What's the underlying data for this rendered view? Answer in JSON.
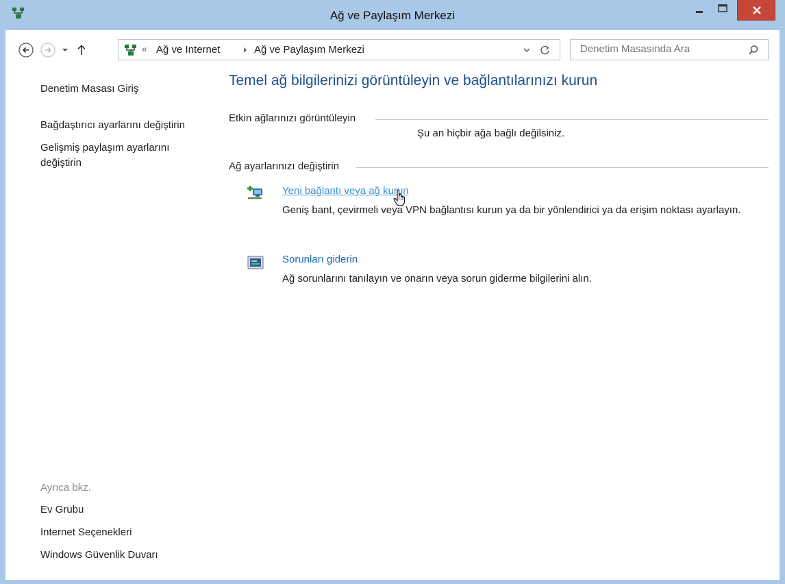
{
  "window": {
    "title": "Ağ ve Paylaşım Merkezi",
    "controls": {
      "minimize": "minimize",
      "maximize": "maximize",
      "close": "close"
    }
  },
  "address_bar": {
    "overflow": "«",
    "breadcrumbs": [
      "Ağ ve Internet",
      "Ağ ve Paylaşım Merkezi"
    ],
    "search_placeholder": "Denetim Masasında Ara"
  },
  "sidebar": {
    "links": [
      {
        "label": "Denetim Masası Giriş"
      },
      {
        "label": "Bağdaştırıcı ayarlarını değiştirin"
      },
      {
        "label": "Gelişmiş paylaşım ayarlarını\ndeğiştirin"
      }
    ],
    "see_also_label": "Ayrıca bkz.",
    "see_also": [
      {
        "label": "Ev Grubu"
      },
      {
        "label": "Internet Seçenekleri"
      },
      {
        "label": "Windows Güvenlik Duvarı"
      }
    ]
  },
  "main": {
    "title": "Temel ağ bilgilerinizi görüntüleyin ve bağlantılarınızı kurun",
    "active_networks": {
      "heading": "Etkin ağlarınızı görüntüleyin",
      "status": "Şu an hiçbir ağa bağlı değilsiniz."
    },
    "change_settings": {
      "heading": "Ağ ayarlarınızı değiştirin",
      "tasks": [
        {
          "icon": "network-setup-icon",
          "label": "Yeni bağlantı veya ağ kurun",
          "description": "Geniş bant, çevirmeli veya VPN bağlantısı kurun ya da bir yönlendirici ya da erişim noktası ayarlayın."
        },
        {
          "icon": "troubleshoot-icon",
          "label": "Sorunları giderin",
          "description": "Ağ sorunlarını tanılayın ve onarın veya sorun giderme bilgilerini alın."
        }
      ]
    }
  },
  "colors": {
    "frame": "#a9c8e8",
    "title_blue": "#1c4f8a",
    "link_blue": "#1a68b4",
    "close_red": "#c7463a"
  }
}
